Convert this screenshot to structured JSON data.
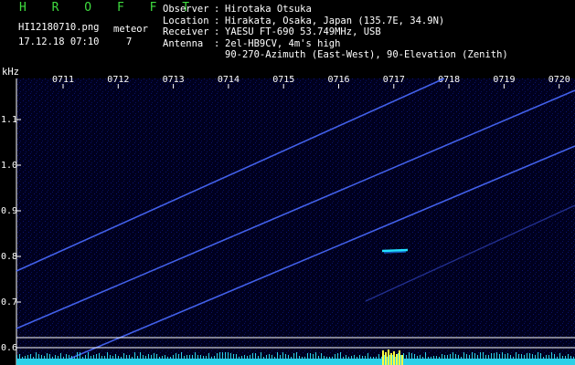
{
  "app": {
    "title": "H R O F F T"
  },
  "file": {
    "filename": "HI12180710.png",
    "meteor_label": "meteor",
    "datetime": "17.12.18 07:10",
    "meteor_count": "7"
  },
  "info": [
    {
      "key": "Observer",
      "value": "Hirotaka Otsuka"
    },
    {
      "key": "Location",
      "value": "Hirakata, Osaka, Japan (135.7E, 34.9N)"
    },
    {
      "key": "Receiver",
      "value": "YAESU FT-690 53.749MHz, USB"
    },
    {
      "key": "Antenna",
      "value": "2el-HB9CV, 4m's high"
    },
    {
      "key": "",
      "value": "90-270-Azimuth (East-West), 90-Elevation (Zenith)"
    }
  ],
  "axis": {
    "unit": "kHz",
    "time_labels": [
      "0711",
      "0712",
      "0713",
      "0714",
      "0715",
      "0716",
      "0717",
      "0718",
      "0719",
      "0720"
    ],
    "freq_labels": [
      "1.1",
      "1.0",
      "0.9",
      "0.8",
      "0.7",
      "0.6"
    ]
  },
  "colors": {
    "background": "#00001e",
    "trace": "#4a6bff",
    "echo": "#22e0ff",
    "baseline": "#2cd0e8",
    "burst": "#ffff40",
    "title": "#3fdc3f"
  }
}
